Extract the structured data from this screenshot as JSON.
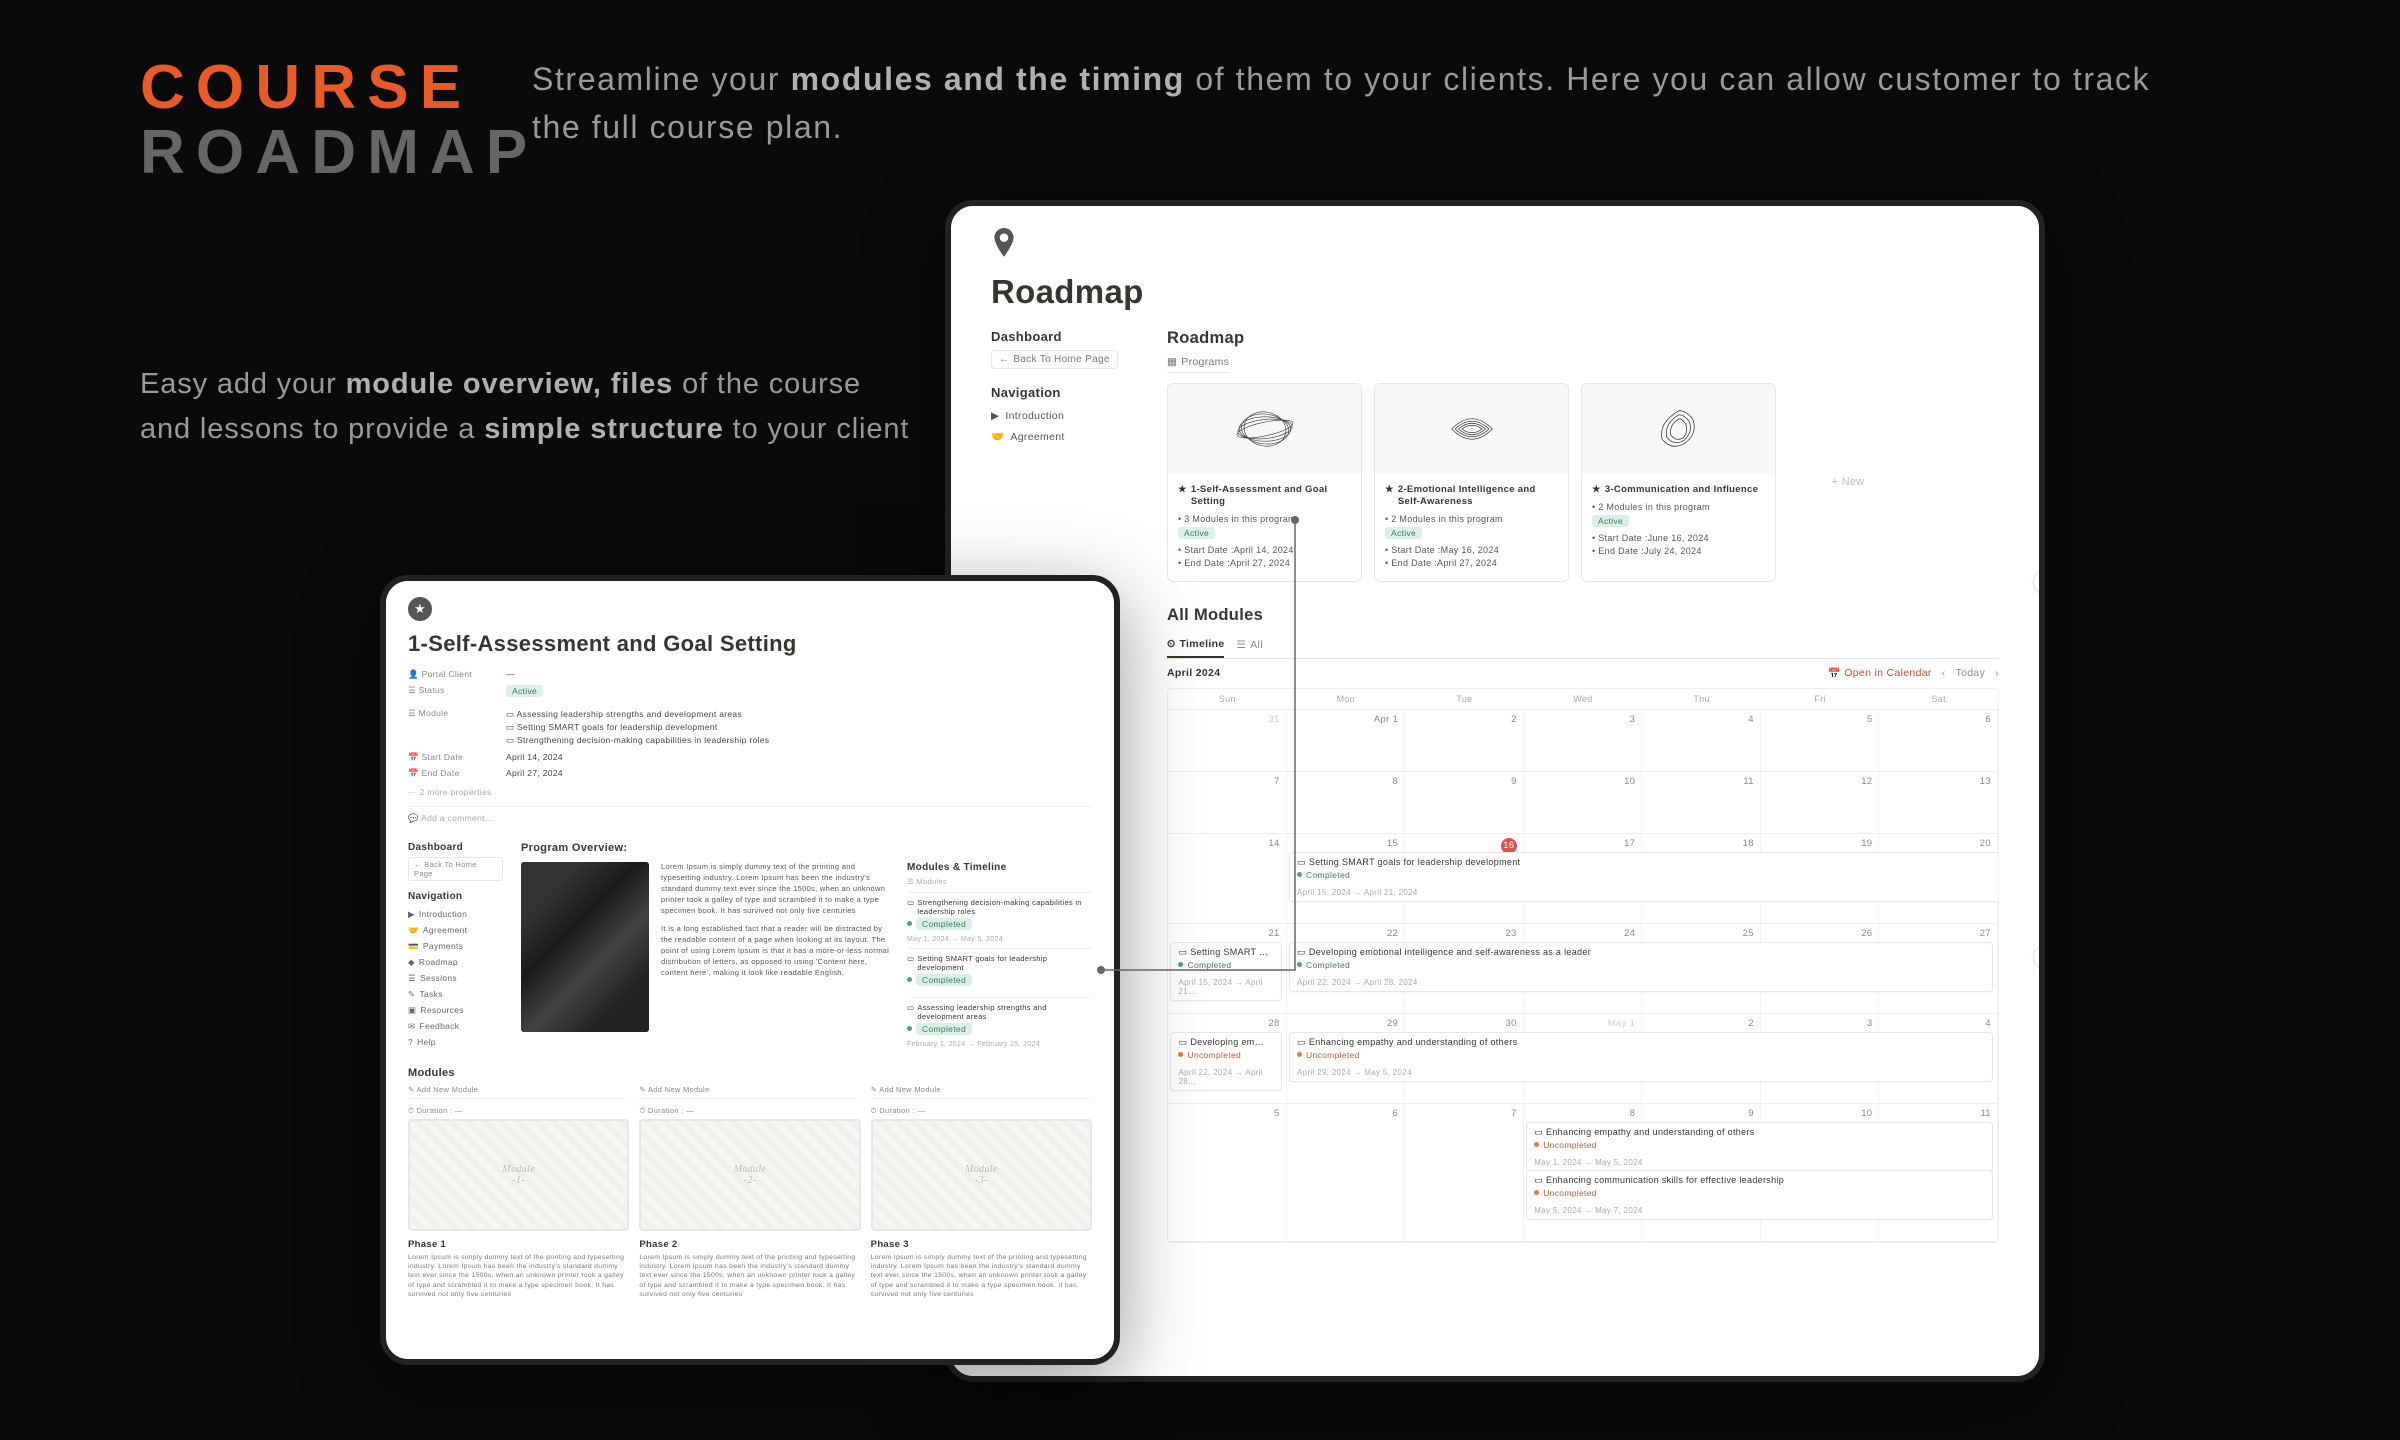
{
  "hero": {
    "title_l1": "COURSE",
    "title_l2": "ROADMAP",
    "desc_pre": "Streamline your ",
    "desc_bold": "modules and the timing",
    "desc_post": " of them to your clients. Here you can allow customer to track the full course plan."
  },
  "side": {
    "p1a": "Easy add your ",
    "p1b": "module overview, files",
    "p1c": " of the course and lessons to provide a ",
    "p1d": "simple structure",
    "p1e": " to your client"
  },
  "right": {
    "pin": "📍",
    "title": "Roadmap",
    "sidebar": {
      "dashboard": "Dashboard",
      "back": "Back To Home Page",
      "nav": "Navigation",
      "items": [
        {
          "icon": "▶",
          "label": "Introduction"
        },
        {
          "icon": "🤝",
          "label": "Agreement"
        }
      ]
    },
    "roadmap": {
      "heading": "Roadmap",
      "view": "Programs",
      "cards": [
        {
          "title": "1-Self-Assessment and Goal Setting",
          "modules": "3 Modules in this program",
          "status": "Active",
          "start": "Start Date :April 14, 2024",
          "end": "End Date :April 27, 2024"
        },
        {
          "title": "2-Emotional Intelligence and Self-Awareness",
          "modules": "2 Modules in this program",
          "status": "Active",
          "start": "Start Date :May 16, 2024",
          "end": "End Date :April 27, 2024"
        },
        {
          "title": "3-Communication and Influence",
          "modules": "2 Modules in this program",
          "status": "Active",
          "start": "Start Date :June 16, 2024",
          "end": "End Date :July 24, 2024"
        }
      ],
      "add": "+ New"
    },
    "allmod": {
      "heading": "All Modules",
      "tabs": {
        "timeline": "Timeline",
        "all": "All"
      },
      "month": "April 2024",
      "open_cal": "Open in Calendar",
      "today": "Today",
      "dow": [
        "Sun",
        "Mon",
        "Tue",
        "Wed",
        "Thu",
        "Fri",
        "Sat"
      ],
      "weeks": [
        [
          "31",
          "Apr 1",
          "2",
          "3",
          "4",
          "5",
          "6"
        ],
        [
          "7",
          "8",
          "9",
          "10",
          "11",
          "12",
          "13"
        ],
        [
          "14",
          "15",
          "16",
          "17",
          "18",
          "19",
          "20"
        ],
        [
          "21",
          "22",
          "23",
          "24",
          "25",
          "26",
          "27"
        ],
        [
          "28",
          "29",
          "30",
          "May 1",
          "2",
          "3",
          "4"
        ],
        [
          "5",
          "6",
          "7",
          "8",
          "9",
          "10",
          "11"
        ]
      ],
      "today_cell": "16",
      "events": [
        {
          "title": "Setting SMART goals for leadership development",
          "status": "Completed",
          "statusClass": "g",
          "dates": "April 15, 2024 → April 21, 2024",
          "row": 2,
          "col": 1,
          "span": 7
        },
        {
          "title": "Setting SMART …",
          "status": "Completed",
          "statusClass": "g",
          "dates": "April 15, 2024 → April 21…",
          "row": 3,
          "col": 0,
          "span": 1
        },
        {
          "title": "Developing emotional intelligence and self-awareness as a leader",
          "status": "Completed",
          "statusClass": "g",
          "dates": "April 22, 2024 → April 28, 2024",
          "row": 3,
          "col": 1,
          "span": 6
        },
        {
          "title": "Developing em…",
          "status": "Uncompleted",
          "statusClass": "o",
          "dates": "April 22, 2024 → April 28…",
          "row": 4,
          "col": 0,
          "span": 1
        },
        {
          "title": "Enhancing empathy and understanding of others",
          "status": "Uncompleted",
          "statusClass": "o",
          "dates": "April 29, 2024 → May 5, 2024",
          "row": 4,
          "col": 1,
          "span": 6
        },
        {
          "title": "Enhancing empathy and understanding of others",
          "status": "Uncompleted",
          "statusClass": "o",
          "dates": "May 1, 2024 → May 5, 2024",
          "row": 5,
          "col": 3,
          "span": 4,
          "offset": 0
        },
        {
          "title": "Enhancing communication skills for effective leadership",
          "status": "Uncompleted",
          "statusClass": "o",
          "dates": "May 5, 2024 → May 7, 2024",
          "row": 5,
          "col": 3,
          "span": 4,
          "offset": 1
        }
      ]
    },
    "help": "?"
  },
  "left": {
    "star": "★",
    "title": "1-Self-Assessment and Goal Setting",
    "meta": {
      "k1": "👤 Portal Client",
      "v1": "—",
      "k2": "☰ Status",
      "v2": "Active",
      "k3": "☰ Module",
      "bullets": [
        "Assessing leadership strengths and development areas",
        "Setting SMART goals for leadership development",
        "Strengthening decision-making capabilities in leadership roles"
      ],
      "k4": "📅 Start Date",
      "v4": "April 14, 2024",
      "k5": "📅 End Date",
      "v5": "April 27, 2024",
      "more": "⋯ 2 more properties",
      "comment": "💬 Add a comment…"
    },
    "sidebar": {
      "dashboard": "Dashboard",
      "back": "← Back To Home Page",
      "nav": "Navigation",
      "items": [
        {
          "i": "▶",
          "l": "Introduction"
        },
        {
          "i": "🤝",
          "l": "Agreement"
        },
        {
          "i": "💳",
          "l": "Payments"
        },
        {
          "i": "◆",
          "l": "Roadmap"
        },
        {
          "i": "☰",
          "l": "Sessions"
        },
        {
          "i": "✎",
          "l": "Tasks"
        },
        {
          "i": "▣",
          "l": "Resources"
        },
        {
          "i": "✉",
          "l": "Feedback"
        },
        {
          "i": "?",
          "l": "Help"
        }
      ]
    },
    "overview": {
      "heading": "Program Overview:",
      "p1": "Lorem Ipsum is simply dummy text of the printing and typesetting industry. Lorem Ipsum has been the industry's standard dummy text ever since the 1500s, when an unknown printer took a galley of type and scrambled it to make a type specimen book. It has survived not only five centuries",
      "p2": "It is a long established fact that a reader will be distracted by the readable content of a page when looking at its layout. The point of using Lorem Ipsum is that it has a more-or-less normal distribution of letters, as opposed to using 'Content here, content here', making it look like readable English."
    },
    "mt": {
      "heading": "Modules & Timeline",
      "sub": "☰ Modules",
      "items": [
        {
          "t": "Strengthening decision-making capabilities in leadership roles",
          "s": "Completed",
          "sc": "g",
          "d": "May 1, 2024 → May 5, 2024"
        },
        {
          "t": "Setting SMART goals for leadership development",
          "s": "Completed",
          "sc": "g",
          "d": ""
        },
        {
          "t": "Assessing leadership strengths and development areas",
          "s": "Completed",
          "sc": "g",
          "d": "February 1, 2024 → February 25, 2024"
        }
      ]
    },
    "modules": {
      "heading": "Modules",
      "add": "✎ Add New Module",
      "dur": "⏱ Duration : —",
      "cols": [
        {
          "tile1": "Module",
          "tile2": "-1-",
          "phase": "Phase 1",
          "p": "Lorem Ipsum is simply dummy text of the printing and typesetting industry. Lorem Ipsum has been the industry's standard dummy text ever since the 1500s, when an unknown printer took a galley of type and scrambled it to make a type specimen book. It has survived not only five centuries"
        },
        {
          "tile1": "Module",
          "tile2": "-2-",
          "phase": "Phase 2",
          "p": "Lorem Ipsum is simply dummy text of the printing and typesetting industry. Lorem Ipsum has been the industry's standard dummy text ever since the 1500s, when an unknown printer took a galley of type and scrambled it to make a type specimen book. It has survived not only five centuries"
        },
        {
          "tile1": "Module",
          "tile2": "-3-",
          "phase": "Phase 3",
          "p": "Lorem Ipsum is simply dummy text of the printing and typesetting industry. Lorem Ipsum has been the industry's standard dummy text ever since the 1500s, when an unknown printer took a galley of type and scrambled it to make a type specimen book. It has survived not only five centuries"
        }
      ]
    }
  }
}
